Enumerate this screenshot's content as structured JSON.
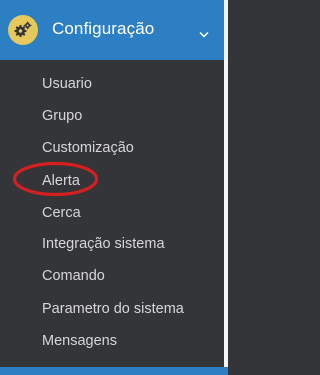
{
  "menu": {
    "title": "Configuração",
    "icon": "cogs-icon",
    "expand_icon": "chevron-down-icon",
    "items": [
      {
        "label": "Usuario"
      },
      {
        "label": "Grupo"
      },
      {
        "label": "Customização"
      },
      {
        "label": "Alerta"
      },
      {
        "label": "Cerca"
      },
      {
        "label": "Integração sistema"
      },
      {
        "label": "Comando"
      },
      {
        "label": "Parametro do sistema"
      },
      {
        "label": "Mensagens"
      }
    ]
  },
  "colors": {
    "header_bg": "#2d7fc4",
    "submenu_bg": "#333538",
    "icon_badge": "#e6c85c",
    "annotation": "#d62020"
  }
}
